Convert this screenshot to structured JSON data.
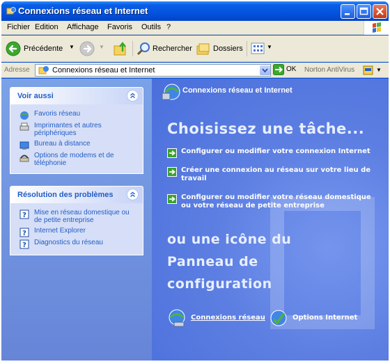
{
  "window": {
    "title": "Connexions réseau et Internet"
  },
  "menu": [
    "Fichier",
    "Edition",
    "Affichage",
    "Favoris",
    "Outils",
    "?"
  ],
  "toolbar": {
    "back_label": "Précédente",
    "search_label": "Rechercher",
    "folders_label": "Dossiers"
  },
  "address": {
    "label": "Adresse",
    "value": "Connexions réseau et Internet",
    "go_label": "OK",
    "norton_label": "Norton AntiVirus"
  },
  "sidebar": {
    "see_also": {
      "title": "Voir aussi",
      "items": [
        {
          "label": "Favoris réseau",
          "icon": "network-places-icon"
        },
        {
          "label": "Imprimantes et autres périphériques",
          "icon": "printer-icon"
        },
        {
          "label": "Bureau à distance",
          "icon": "remote-desktop-icon"
        },
        {
          "label": "Options de modems et de téléphonie",
          "icon": "modem-phone-icon"
        }
      ]
    },
    "troubleshoot": {
      "title": "Résolution des problèmes",
      "items": [
        {
          "label": "Mise en réseau domestique ou de petite entreprise",
          "icon": "help-icon"
        },
        {
          "label": "Internet Explorer",
          "icon": "help-icon"
        },
        {
          "label": "Diagnostics du réseau",
          "icon": "help-icon"
        }
      ]
    }
  },
  "content": {
    "section_title": "Connexions réseau et Internet",
    "heading_task": "Choisissez une tâche...",
    "tasks": [
      "Configurer ou modifier votre connexion Internet",
      "Créer une connexion au réseau sur votre lieu de travail",
      "Configurer ou modifier votre réseau domestique ou votre réseau de petite entreprise"
    ],
    "heading_icon_lines": [
      "ou une icône du",
      "Panneau de",
      "configuration"
    ],
    "cp_items": [
      {
        "label": "Connexions réseau",
        "icon": "network-connections-icon"
      },
      {
        "label": "Options Internet",
        "icon": "internet-options-icon"
      }
    ]
  },
  "colors": {
    "titlebar": "#0454e0",
    "sidebar_link": "#215dc6",
    "content_bg": "#5d7fe2",
    "task_arrow": "#3ea02f"
  }
}
